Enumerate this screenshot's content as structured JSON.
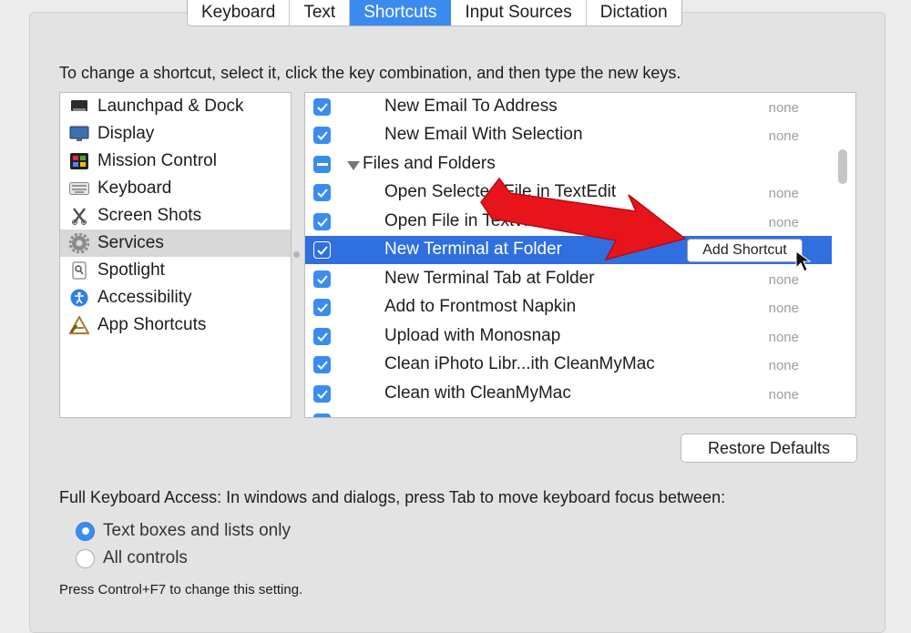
{
  "tabs": [
    {
      "label": "Keyboard",
      "active": false
    },
    {
      "label": "Text",
      "active": false
    },
    {
      "label": "Shortcuts",
      "active": true
    },
    {
      "label": "Input Sources",
      "active": false
    },
    {
      "label": "Dictation",
      "active": false
    }
  ],
  "instructions": "To change a shortcut, select it, click the key combination, and then type the new keys.",
  "categories": [
    {
      "label": "Launchpad & Dock",
      "icon": "launchpad-dock-icon"
    },
    {
      "label": "Display",
      "icon": "display-icon"
    },
    {
      "label": "Mission Control",
      "icon": "mission-control-icon"
    },
    {
      "label": "Keyboard",
      "icon": "keyboard-icon"
    },
    {
      "label": "Screen Shots",
      "icon": "screen-shots-icon"
    },
    {
      "label": "Services",
      "icon": "gear-icon",
      "selected": true
    },
    {
      "label": "Spotlight",
      "icon": "spotlight-icon"
    },
    {
      "label": "Accessibility",
      "icon": "accessibility-icon"
    },
    {
      "label": "App Shortcuts",
      "icon": "app-shortcuts-icon"
    }
  ],
  "services": [
    {
      "label": "New Email To Address",
      "shortcut": "none",
      "checked": true
    },
    {
      "label": "New Email With Selection",
      "shortcut": "none",
      "checked": true
    },
    {
      "label": "Files and Folders",
      "group": true,
      "checked": "mixed"
    },
    {
      "label": "Open Selected File in TextEdit",
      "shortcut": "none",
      "checked": true
    },
    {
      "label": "Open File in TextWrangler",
      "shortcut": "none",
      "checked": true
    },
    {
      "label": "New Terminal at Folder",
      "checked": true,
      "selected": true,
      "button": "Add Shortcut"
    },
    {
      "label": "New Terminal Tab at Folder",
      "shortcut": "none",
      "checked": true
    },
    {
      "label": "Add to Frontmost Napkin",
      "shortcut": "none",
      "checked": true
    },
    {
      "label": "Upload with Monosnap",
      "shortcut": "none",
      "checked": true
    },
    {
      "label": "Clean iPhoto Libr...ith CleanMyMac",
      "shortcut": "none",
      "checked": true
    },
    {
      "label": "Clean with CleanMyMac",
      "shortcut": "none",
      "checked": true
    }
  ],
  "restore_defaults": "Restore Defaults",
  "full_keyboard_access": {
    "label": "Full Keyboard Access: In windows and dialogs, press Tab to move keyboard focus between:",
    "options": [
      {
        "label": "Text boxes and lists only",
        "selected": true
      },
      {
        "label": "All controls",
        "selected": false
      }
    ]
  },
  "hint": "Press Control+F7 to change this setting.",
  "colors": {
    "accent": "#3a8df0",
    "selection": "#2f6fe0",
    "annotation_arrow": "#e8141c"
  }
}
